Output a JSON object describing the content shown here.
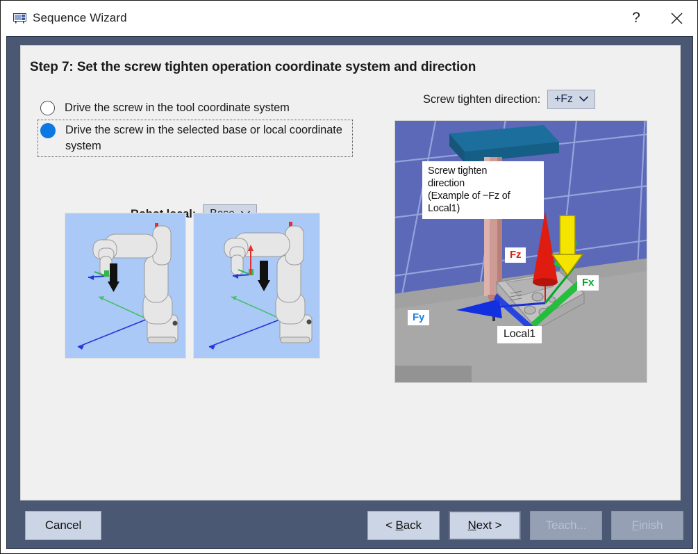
{
  "window": {
    "title": "Sequence Wizard",
    "icon": "wizard-icon",
    "help_label": "?",
    "close_label": "×"
  },
  "content": {
    "step_title": "Step 7: Set the screw tighten operation coordinate system and direction",
    "radio_options": [
      {
        "label": "Drive the screw in the tool coordinate system",
        "selected": false,
        "focused": false
      },
      {
        "label": "Drive the screw in the selected base or local coordinate system",
        "selected": true,
        "focused": true
      }
    ],
    "robot_local": {
      "label": "Robot local:",
      "value": "Base"
    },
    "screw_direction": {
      "label": "Screw tighten direction:",
      "value": "+Fz"
    },
    "robot_images": [
      {
        "name": "robot-tool-coordinate-preview"
      },
      {
        "name": "robot-base-local-coordinate-preview"
      }
    ],
    "preview": {
      "callout": "Screw tighten\ndirection\n(Example of −Fz of\nLocal1)",
      "labels": {
        "fz": "Fz",
        "fx": "Fx",
        "fy": "Fy",
        "local": "Local1"
      }
    }
  },
  "footer": {
    "cancel": "Cancel",
    "back_pre": "< ",
    "back_accel": "B",
    "back_post": "ack",
    "next_accel": "N",
    "next_post": "ext >",
    "teach": "Teach...",
    "finish_accel": "F",
    "finish_post": "inish"
  },
  "colors": {
    "accent": "#0b78e3",
    "frame": "#4b5873",
    "panel": "#f0f0f0",
    "button": "#ccd5e6",
    "fz": "#e01b10",
    "fx": "#00a828",
    "fy": "#1e7fe0"
  }
}
